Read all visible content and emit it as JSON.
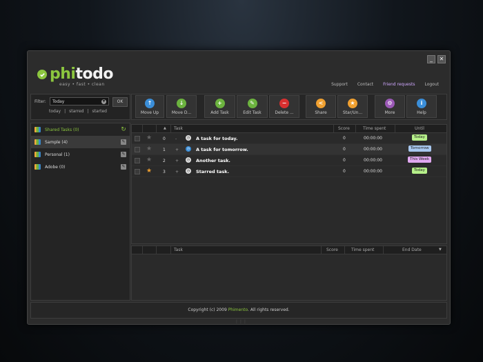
{
  "app": {
    "logo_part1": "phi",
    "logo_part2": "todo",
    "tagline": "easy • fast • clean"
  },
  "window_controls": {
    "minimize": "_",
    "close": "✕"
  },
  "top_links": [
    "Support",
    "Contact",
    "Friend requests",
    "Logout"
  ],
  "filter": {
    "label": "Filter:",
    "selected": "Today",
    "ok": "OK",
    "quick": [
      "today",
      "|",
      "starred",
      "|",
      "started"
    ]
  },
  "toolbar": [
    {
      "label": "Move Up",
      "icon": "arrow-up-icon",
      "color": "#3b8ed8",
      "glyph": "↑"
    },
    {
      "label": "Move D...",
      "icon": "arrow-down-icon",
      "color": "#6cb33f",
      "glyph": "↓"
    },
    {
      "label": "Add Task",
      "icon": "plus-icon",
      "color": "#6cb33f",
      "glyph": "+"
    },
    {
      "label": "Edit Task",
      "icon": "pencil-icon",
      "color": "#6cb33f",
      "glyph": "✎"
    },
    {
      "label": "Delete ...",
      "icon": "minus-icon",
      "color": "#d83030",
      "glyph": "−"
    },
    {
      "label": "Share",
      "icon": "share-icon",
      "color": "#f0a030",
      "glyph": "<"
    },
    {
      "label": "Star/Un...",
      "icon": "star-icon",
      "color": "#f0a030",
      "glyph": "★"
    },
    {
      "label": "More",
      "icon": "gear-icon",
      "color": "#9b59b6",
      "glyph": "⚙"
    },
    {
      "label": "Help",
      "icon": "info-icon",
      "color": "#3b8ed8",
      "glyph": "i"
    }
  ],
  "projects": [
    {
      "label": "Shared Tasks (0)",
      "highlight": true,
      "right": "refresh-icon"
    },
    {
      "label": "Sample (4)",
      "selected": true,
      "right": "edit-icon"
    },
    {
      "label": "Personal (1)",
      "right": "edit-icon"
    },
    {
      "label": "Adobe (0)",
      "right": "edit-icon"
    }
  ],
  "task_grid": {
    "headers": {
      "sort": "▲",
      "task": "Task",
      "score": "Score",
      "time": "Time spent",
      "until": "Until"
    },
    "rows": [
      {
        "idx": "0",
        "exp": "-",
        "title": "A task for today.",
        "score": "0",
        "time": "00:00:00",
        "until": "Today",
        "until_color": "#b6f08a",
        "starred": false,
        "icon_blue": false
      },
      {
        "idx": "1",
        "exp": "+",
        "title": "A task for tomorrow.",
        "score": "0",
        "time": "00:00:00",
        "until": "Tomorrow",
        "until_color": "#a8c8f0",
        "starred": false,
        "icon_blue": true
      },
      {
        "idx": "2",
        "exp": "+",
        "title": "Another task.",
        "score": "0",
        "time": "00:00:00",
        "until": "This Week",
        "until_color": "#e0a8f0",
        "starred": false,
        "icon_blue": false
      },
      {
        "idx": "3",
        "exp": "+",
        "title": "Starred task.",
        "score": "0",
        "time": "00:00:00",
        "until": "Today",
        "until_color": "#b6f08a",
        "starred": true,
        "icon_blue": false
      }
    ]
  },
  "sub_grid": {
    "headers": {
      "task": "Task",
      "score": "Score",
      "time": "Time spent",
      "end": "End Date",
      "arrow": "▼"
    }
  },
  "footer": {
    "prefix": "Copyright (c) 2009",
    "brand": "Phimento",
    "suffix": ". All rights reserved."
  }
}
